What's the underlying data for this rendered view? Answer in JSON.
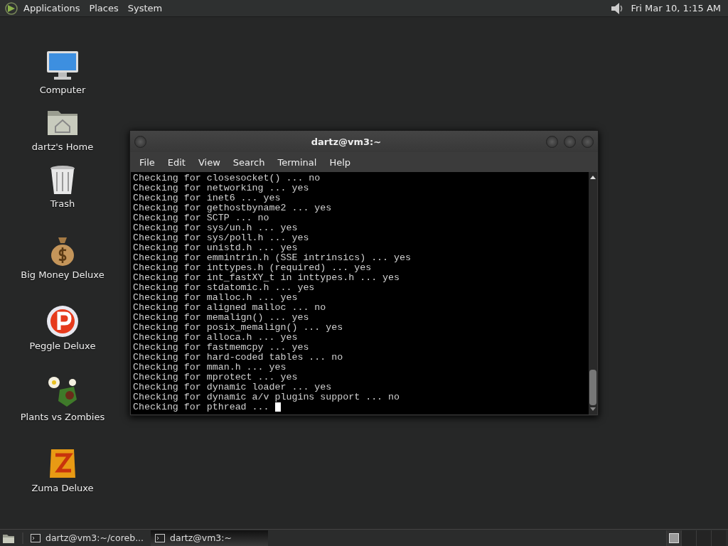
{
  "top_panel": {
    "menus": [
      "Applications",
      "Places",
      "System"
    ],
    "clock": "Fri Mar 10, 1:15 AM"
  },
  "desktop_icons": [
    {
      "label": "Computer",
      "kind": "computer"
    },
    {
      "label": "dartz's Home",
      "kind": "home"
    },
    {
      "label": "Trash",
      "kind": "trash"
    },
    {
      "label": "Big Money Deluxe",
      "kind": "money"
    },
    {
      "label": "Peggle Deluxe",
      "kind": "peggle"
    },
    {
      "label": "Plants vs Zombies",
      "kind": "plants"
    },
    {
      "label": "Zuma Deluxe",
      "kind": "zuma"
    }
  ],
  "terminal": {
    "title": "dartz@vm3:~",
    "menu": [
      "File",
      "Edit",
      "View",
      "Search",
      "Terminal",
      "Help"
    ],
    "lines": [
      "Checking for closesocket() ... no",
      "Checking for networking ... yes",
      "Checking for inet6 ... yes",
      "Checking for gethostbyname2 ... yes",
      "Checking for SCTP ... no",
      "Checking for sys/un.h ... yes",
      "Checking for sys/poll.h ... yes",
      "Checking for unistd.h ... yes",
      "Checking for emmintrin.h (SSE intrinsics) ... yes",
      "Checking for inttypes.h (required) ... yes",
      "Checking for int_fastXY_t in inttypes.h ... yes",
      "Checking for stdatomic.h ... yes",
      "Checking for malloc.h ... yes",
      "Checking for aligned malloc ... no",
      "Checking for memalign() ... yes",
      "Checking for posix_memalign() ... yes",
      "Checking for alloca.h ... yes",
      "Checking for fastmemcpy ... yes",
      "Checking for hard-coded tables ... no",
      "Checking for mman.h ... yes",
      "Checking for mprotect ... yes",
      "Checking for dynamic loader ... yes",
      "Checking for dynamic a/v plugins support ... no",
      "Checking for pthread ... "
    ]
  },
  "taskbar": {
    "tasks": [
      {
        "label": "dartz@vm3:~/coreb...",
        "selected": false
      },
      {
        "label": "dartz@vm3:~",
        "selected": true
      }
    ],
    "workspaces": [
      {
        "selected": true
      },
      {
        "selected": false
      },
      {
        "selected": false
      },
      {
        "selected": false
      }
    ]
  }
}
